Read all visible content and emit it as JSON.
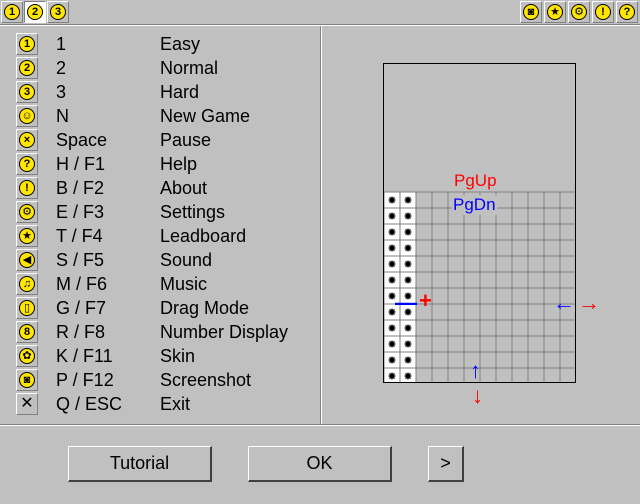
{
  "toolbar_left": [
    {
      "label": "1",
      "active": false
    },
    {
      "label": "2",
      "active": true
    },
    {
      "label": "3",
      "active": false
    }
  ],
  "toolbar_right": [
    {
      "icon": "camera-icon"
    },
    {
      "icon": "star-icon"
    },
    {
      "icon": "gear-icon"
    },
    {
      "icon": "exclamation-icon"
    },
    {
      "icon": "question-icon"
    }
  ],
  "shortcuts": [
    {
      "icon": "one-badge-icon",
      "glyph": "1",
      "key": "1",
      "action": "Easy"
    },
    {
      "icon": "two-badge-icon",
      "glyph": "2",
      "key": "2",
      "action": "Normal"
    },
    {
      "icon": "three-badge-icon",
      "glyph": "3",
      "key": "3",
      "action": "Hard"
    },
    {
      "icon": "smiley-icon",
      "glyph": "☺",
      "key": "N",
      "action": "New Game"
    },
    {
      "icon": "pause-face-icon",
      "glyph": "×",
      "key": "Space",
      "action": "Pause"
    },
    {
      "icon": "question-icon",
      "glyph": "?",
      "key": "H / F1",
      "action": "Help"
    },
    {
      "icon": "exclamation-icon",
      "glyph": "!",
      "key": "B / F2",
      "action": "About"
    },
    {
      "icon": "gear-icon",
      "glyph": "⚙",
      "key": "E / F3",
      "action": "Settings"
    },
    {
      "icon": "star-icon",
      "glyph": "★",
      "key": "T / F4",
      "action": "Leadboard"
    },
    {
      "icon": "speaker-icon",
      "glyph": "◀",
      "key": "S / F5",
      "action": "Sound"
    },
    {
      "icon": "music-note-icon",
      "glyph": "♫",
      "key": "M / F6",
      "action": "Music"
    },
    {
      "icon": "mouse-icon",
      "glyph": "▯",
      "key": "G / F7",
      "action": "Drag Mode"
    },
    {
      "icon": "number-display-icon",
      "glyph": "8",
      "key": "R / F8",
      "action": "Number Display"
    },
    {
      "icon": "palette-icon",
      "glyph": "✿",
      "key": "K / F11",
      "action": "Skin"
    },
    {
      "icon": "camera-icon",
      "glyph": "◙",
      "key": "P / F12",
      "action": "Screenshot"
    },
    {
      "icon": "close-icon",
      "glyph": "✕",
      "key": "Q / ESC",
      "action": "Exit"
    }
  ],
  "preview": {
    "pgup": "PgUp",
    "pgdn": "PgDn",
    "colors": {
      "red": "#ff0000",
      "blue": "#0000ff"
    }
  },
  "buttons": {
    "tutorial": "Tutorial",
    "ok": "OK",
    "next": ">"
  }
}
